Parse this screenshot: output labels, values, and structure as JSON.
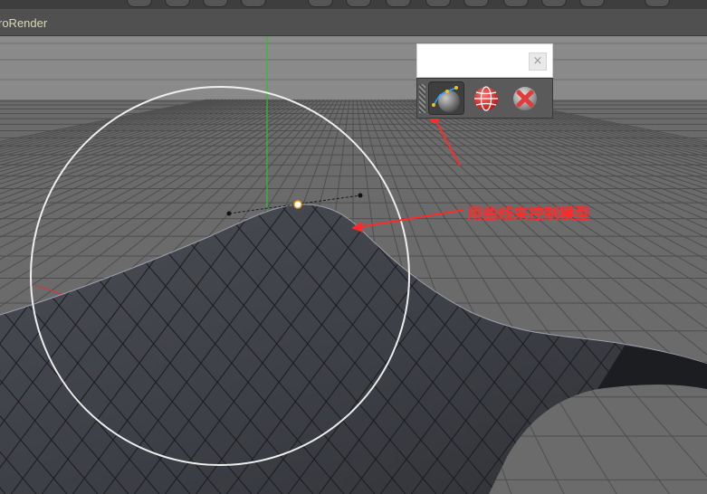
{
  "app": {
    "menu_label": "roRender"
  },
  "toolbar": {
    "close_glyph": "×",
    "tools": [
      {
        "icon": "spline-deformer-icon"
      },
      {
        "icon": "sphere-grid-icon"
      },
      {
        "icon": "delete-icon"
      }
    ]
  },
  "annotation": {
    "text": "用曲线来控制模型",
    "color": "#ff2a2a"
  },
  "colors": {
    "viewport_bg": "#6b6b6b",
    "mesh": "#3c3e44",
    "wire": "#1a1a1a",
    "y_axis": "#2fbf2f",
    "annotation": "#ff2a2a"
  }
}
